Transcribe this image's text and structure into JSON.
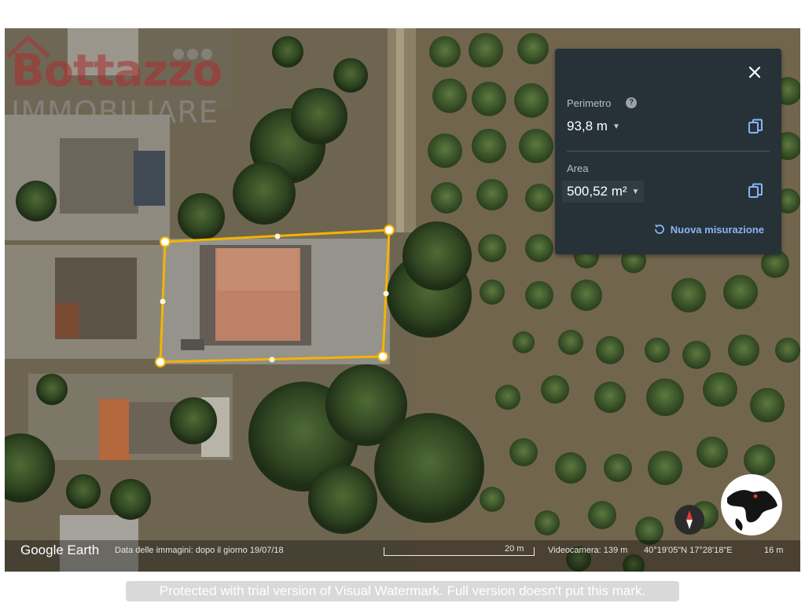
{
  "watermark": {
    "brand_top": "Bottazzo",
    "brand_bottom": "IMMOBILIARE",
    "trial_notice": "Protected with trial version of Visual Watermark. Full version doesn't put this mark."
  },
  "measure_panel": {
    "close_icon": "close-icon",
    "perimeter_label": "Perimetro",
    "help_icon": "help-icon",
    "perimeter_value": "93,8 m",
    "area_label": "Area",
    "area_value": "500,52 m²",
    "copy_icon": "copy-icon",
    "new_measure_label": "Nuova misurazione",
    "accent_color": "#8ab4f8"
  },
  "status_bar": {
    "app_logo": "Google Earth",
    "imagery_date": "Data delle immagini: dopo il giorno 19/07/18",
    "scale_label": "20 m",
    "camera": "Videocamera: 139 m",
    "coordinates": "40°19'05\"N 17°28'18\"E",
    "elevation": "16 m"
  },
  "map": {
    "polygon_color": "#f4b400",
    "compass_icon": "compass-icon",
    "globe_icon": "globe-icon"
  }
}
